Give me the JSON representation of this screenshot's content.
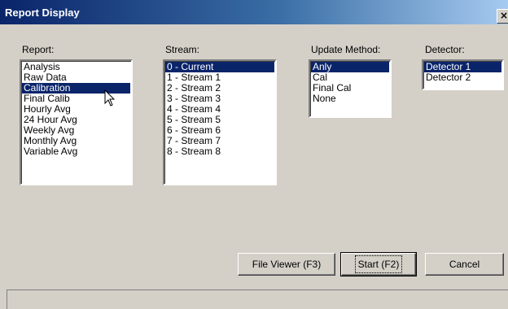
{
  "window": {
    "title": "Report Display",
    "close_glyph": "×"
  },
  "report": {
    "label": "Report:",
    "items": [
      "Analysis",
      "Raw Data",
      "Calibration",
      "Final Calib",
      "Hourly Avg",
      "24 Hour Avg",
      "Weekly Avg",
      "Monthly Avg",
      "Variable Avg"
    ],
    "selected": "Calibration"
  },
  "stream": {
    "label": "Stream:",
    "items": [
      "0 - Current",
      "1 - Stream 1",
      "2 - Stream 2",
      "3 - Stream 3",
      "4 - Stream 4",
      "5 - Stream 5",
      "6 - Stream 6",
      "7 - Stream 7",
      "8 - Stream 8"
    ],
    "selected": "0 - Current"
  },
  "update_method": {
    "label": "Update Method:",
    "items": [
      "Anly",
      "Cal",
      "Final Cal",
      "None"
    ],
    "selected": "Anly"
  },
  "detector": {
    "label": "Detector:",
    "items": [
      "Detector 1",
      "Detector 2"
    ],
    "selected": "Detector 1"
  },
  "buttons": {
    "file_viewer": "File Viewer (F3)",
    "start": "Start (F2)",
    "cancel": "Cancel"
  },
  "colors": {
    "selection": "#0a246a",
    "face": "#d4d0c8"
  },
  "icons": {
    "cursor": "mouse-pointer-icon"
  }
}
